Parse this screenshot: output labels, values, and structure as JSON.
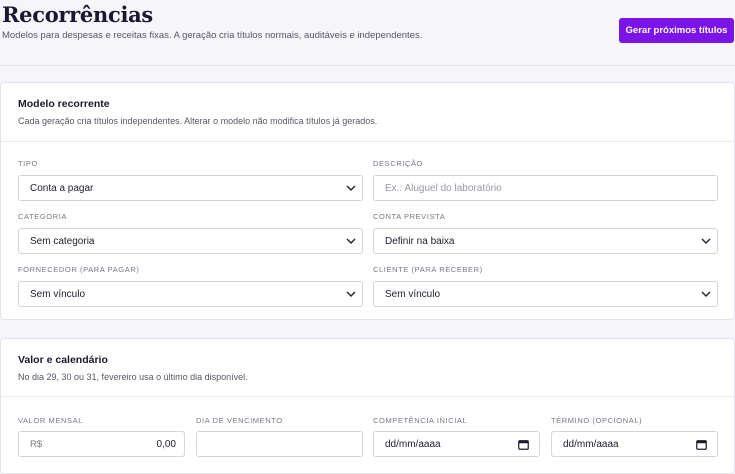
{
  "header": {
    "title": "Recorrências",
    "subtitle": "Modelos para despesas e receitas fixas. A geração cria títulos normais, auditáveis e independentes.",
    "generate_button": "Gerar próximos títulos"
  },
  "model_card": {
    "title": "Modelo recorrente",
    "description": "Cada geração cria títulos independentes. Alterar o modelo não modifica títulos já gerados.",
    "fields": {
      "tipo": {
        "label": "TIPO",
        "value": "Conta a pagar"
      },
      "descricao": {
        "label": "DESCRIÇÃO",
        "placeholder": "Ex.: Aluguel do laboratório"
      },
      "categoria": {
        "label": "CATEGORIA",
        "value": "Sem categoria"
      },
      "conta_prevista": {
        "label": "CONTA PREVISTA",
        "value": "Definir na baixa"
      },
      "fornecedor": {
        "label": "FORNECEDOR (PARA PAGAR)",
        "value": "Sem vínculo"
      },
      "cliente": {
        "label": "CLIENTE (PARA RECEBER)",
        "value": "Sem vínculo"
      }
    }
  },
  "value_card": {
    "title": "Valor e calendário",
    "description": "No dia 29, 30 ou 31, fevereiro usa o último dia disponível.",
    "fields": {
      "valor_mensal": {
        "label": "VALOR MENSAL",
        "prefix": "R$",
        "value": "0,00"
      },
      "dia_vencimento": {
        "label": "DIA DE VENCIMENTO",
        "value": ""
      },
      "competencia_inicial": {
        "label": "COMPETÊNCIA INICIAL",
        "value": "dd/mm/aaaa"
      },
      "termino": {
        "label": "TÉRMINO (OPCIONAL)",
        "value": "dd/mm/aaaa"
      }
    }
  },
  "colors": {
    "accent": "#7b14e6",
    "background": "#f6f5fa",
    "card": "#ffffff",
    "border": "#d6d2de"
  },
  "icons": {
    "select": "chevron-down-icon",
    "date": "calendar-icon"
  }
}
